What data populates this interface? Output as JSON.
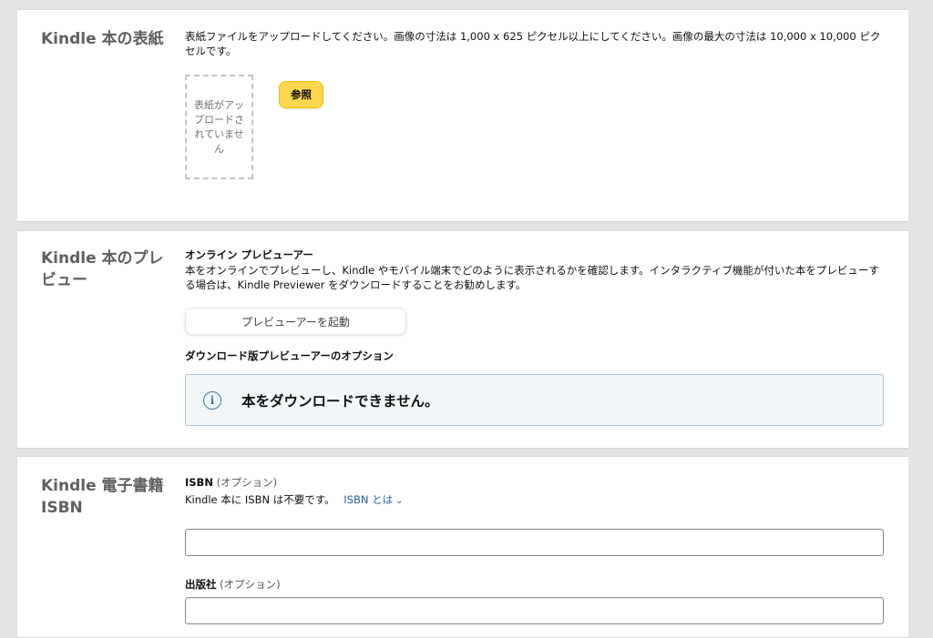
{
  "cover": {
    "title": "Kindle 本の表紙",
    "instructions": "表紙ファイルをアップロードしてください。画像の寸法は 1,000 x 625 ピクセル以上にしてください。画像の最大の寸法は 10,000 x 10,000 ピクセルです。",
    "placeholder": "表紙がアップロードされていません",
    "browse_label": "参照",
    "accent_color": "#ffd84f"
  },
  "preview": {
    "title": "Kindle 本のプレビュー",
    "online_heading": "オンライン プレビューアー",
    "online_description": "本をオンラインでプレビューし、Kindle やモバイル端末でどのように表示されるかを確認します。インタラクティブ機能が付いた本をプレビューする場合は、Kindle Previewer をダウンロードすることをお勧めします。",
    "launch_label": "プレビューアーを起動",
    "download_heading": "ダウンロード版プレビューアーのオプション",
    "alert_icon": "info-icon",
    "alert_text": "本をダウンロードできません。"
  },
  "isbn": {
    "title": "Kindle 電子書籍 ISBN",
    "isbn_label": "ISBN",
    "optional_label": "(オプション)",
    "not_required_text": "Kindle 本に ISBN は不要です。",
    "what_is_link": "ISBN とは",
    "isbn_value": "",
    "publisher_label": "出版社",
    "publisher_optional_label": "(オプション)",
    "publisher_value": "",
    "link_color": "#2162a1"
  }
}
